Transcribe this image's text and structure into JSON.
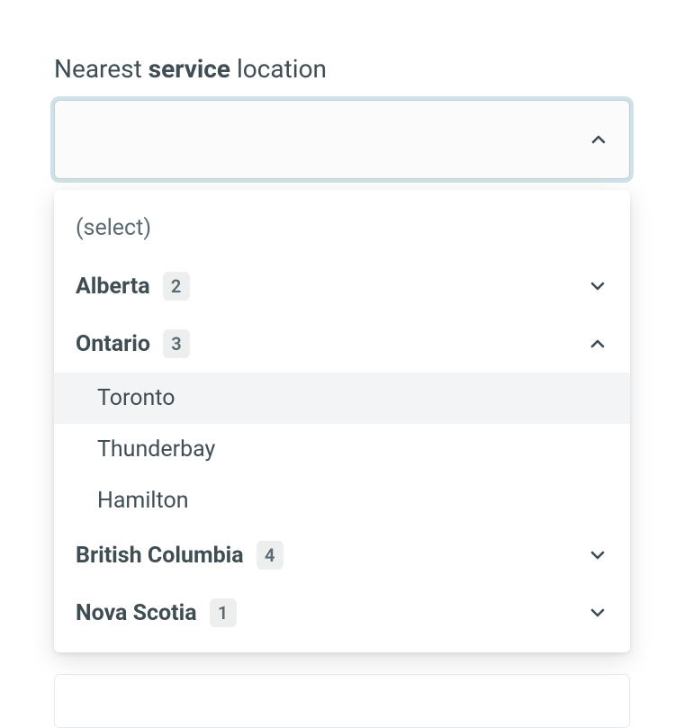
{
  "label": {
    "prefix": "Nearest ",
    "bold": "service",
    "suffix": " location"
  },
  "input": {
    "value": ""
  },
  "dropdown": {
    "placeholder": "(select)",
    "groups": [
      {
        "name": "Alberta",
        "count": "2",
        "expanded": false,
        "items": []
      },
      {
        "name": "Ontario",
        "count": "3",
        "expanded": true,
        "items": [
          {
            "label": "Toronto",
            "highlight": true
          },
          {
            "label": "Thunderbay",
            "highlight": false
          },
          {
            "label": "Hamilton",
            "highlight": false
          }
        ]
      },
      {
        "name": "British Columbia",
        "count": "4",
        "expanded": false,
        "items": []
      },
      {
        "name": "Nova Scotia",
        "count": "1",
        "expanded": false,
        "items": []
      }
    ]
  }
}
